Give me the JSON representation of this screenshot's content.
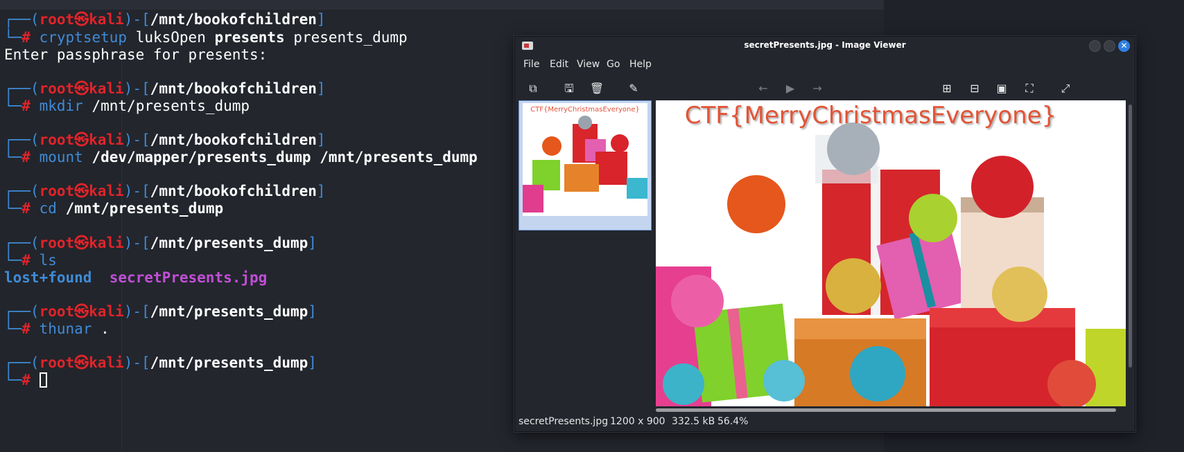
{
  "terminal": {
    "host_user": "root",
    "host_name": "kali",
    "prompt_symbol": "#",
    "blocks": [
      {
        "path": "/mnt/bookofchildren",
        "cmd": "cryptsetup",
        "args_bold": "presents",
        "args": "luksOpen",
        "args_tail": "presents_dump"
      },
      {
        "path": "/mnt/bookofchildren",
        "cmd": "mkdir",
        "args": "/mnt/presents_dump"
      },
      {
        "path": "/mnt/bookofchildren",
        "cmd": "mount",
        "args": "/dev/mapper/presents_dump /mnt/presents_dump"
      },
      {
        "path": "/mnt/bookofchildren",
        "cmd": "cd",
        "args": "/mnt/presents_dump"
      },
      {
        "path": "/mnt/presents_dump",
        "cmd": "ls",
        "args": ""
      },
      {
        "path": "/mnt/presents_dump",
        "cmd": "thunar",
        "args": "."
      },
      {
        "path": "/mnt/presents_dump",
        "cmd": "",
        "args": ""
      }
    ],
    "passphrase_prompt": "Enter passphrase for presents:",
    "ls_output": {
      "dir": "lost+found",
      "file": "secretPresents.jpg"
    }
  },
  "viewer": {
    "title": "secretPresents.jpg - Image Viewer",
    "menu": [
      "File",
      "Edit",
      "View",
      "Go",
      "Help"
    ],
    "toolbar_icons": [
      "open-icon",
      "save-icon",
      "delete-icon",
      "edit-icon",
      "back-arrow-icon",
      "play-icon",
      "forward-arrow-icon",
      "zoom-in-icon",
      "zoom-out-icon",
      "zoom-100-icon",
      "fit-icon",
      "fullscreen-icon"
    ],
    "image_caption": "CTF{MerryChristmasEveryone}",
    "status": {
      "filename": "secretPresents.jpg",
      "dimensions": "1200 x 900",
      "size": "332.5 kB",
      "zoom": "56.4%"
    }
  },
  "colors": {
    "prompt_blue": "#3f8bd8",
    "prompt_red": "#e0242a",
    "image_file": "#c14fd6",
    "ctf_text": "#e25436"
  }
}
